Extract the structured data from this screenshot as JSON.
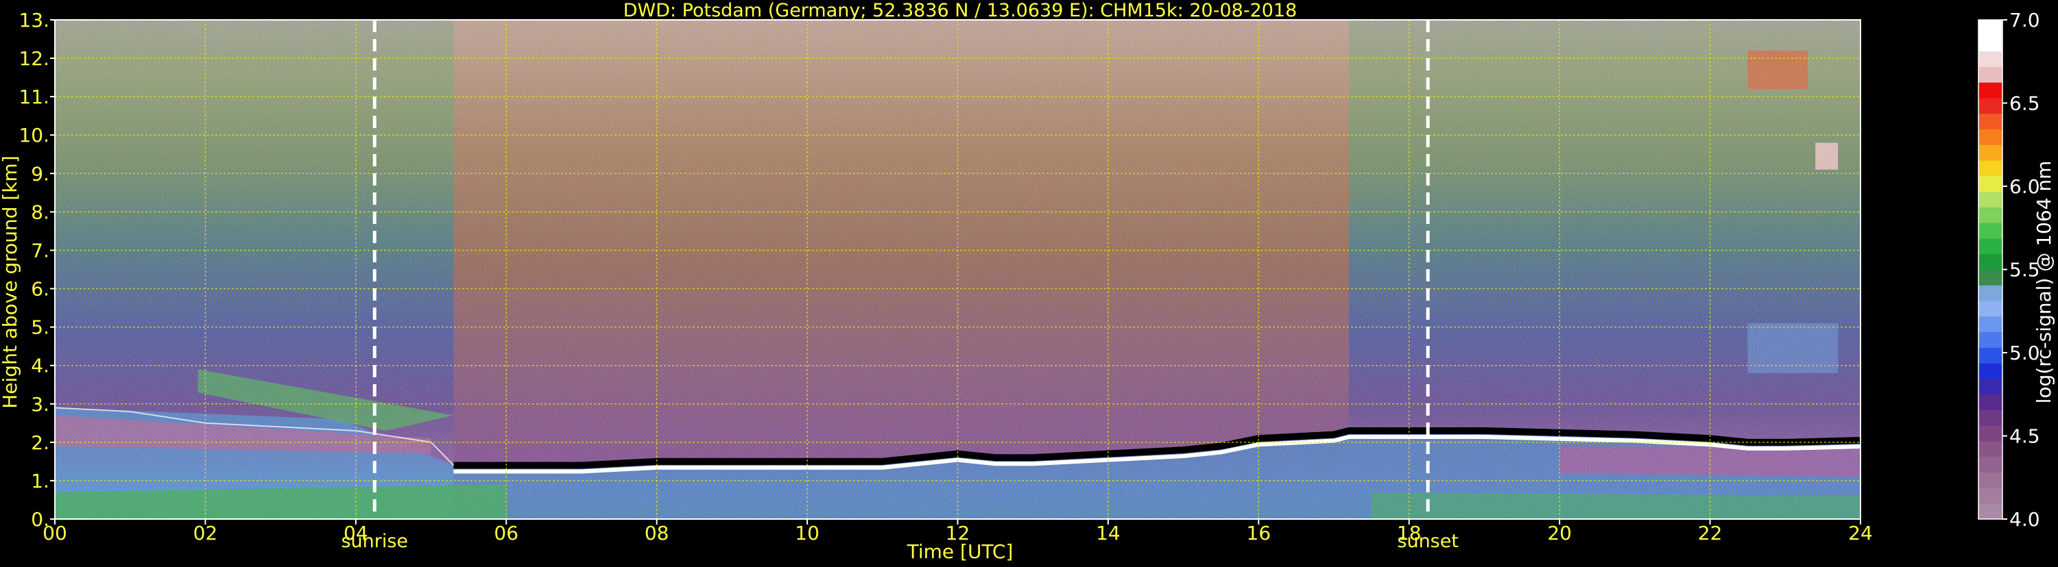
{
  "chart_data": {
    "type": "heatmap",
    "title": "DWD: Potsdam (Germany; 52.3836 N / 13.0639 E):    CHM15k: 20-08-2018",
    "xlabel": "Time [UTC]",
    "ylabel": "Height above ground [km]",
    "xlim": [
      0,
      24
    ],
    "ylim": [
      0,
      13
    ],
    "x_ticks": [
      "00",
      "02",
      "04",
      "06",
      "08",
      "10",
      "12",
      "14",
      "16",
      "18",
      "20",
      "22",
      "24"
    ],
    "y_ticks": [
      "0.",
      "1.",
      "2.",
      "3.",
      "4.",
      "5.",
      "6.",
      "7.",
      "8.",
      "9.",
      "10.",
      "11.",
      "12.",
      "13."
    ],
    "grid": true,
    "annotations": [
      {
        "label": "sunrise",
        "x": 4.25
      },
      {
        "label": "sunset",
        "x": 18.25
      }
    ],
    "colorbar": {
      "label": "log(rc-signal) @ 1064 nm",
      "range": [
        4.0,
        7.0
      ],
      "ticks": [
        "4.0",
        "4.5",
        "5.0",
        "5.5",
        "6.0",
        "6.5",
        "7.0"
      ],
      "colors": [
        "#a98aa4",
        "#a37f9d",
        "#9c7296",
        "#93648f",
        "#8a5688",
        "#7d4682",
        "#6e3a86",
        "#5a2a8f",
        "#3a2ab0",
        "#1d2fd8",
        "#2b55e6",
        "#4c79ee",
        "#6d96f0",
        "#8fb0f2",
        "#7ca8dc",
        "#3b8c4a",
        "#1f9a3a",
        "#2ab344",
        "#4bc44e",
        "#7fd25a",
        "#b2e064",
        "#e6ec44",
        "#f8d21e",
        "#f9a91a",
        "#f77e1a",
        "#f25a22",
        "#ea2a20",
        "#f00c0c",
        "#e9bcc0",
        "#f2dada",
        "#ffffff",
        "#ffffff"
      ]
    },
    "series": [
      {
        "name": "cloud base height (white/black band)",
        "x": [
          5.3,
          6,
          7,
          8,
          9,
          10,
          11,
          12,
          12.5,
          13,
          14,
          15,
          15.5,
          16,
          17,
          17.2,
          18,
          19,
          20,
          21,
          22,
          22.5,
          23,
          24
        ],
        "y": [
          1.4,
          1.4,
          1.4,
          1.5,
          1.5,
          1.5,
          1.5,
          1.7,
          1.6,
          1.6,
          1.7,
          1.8,
          1.9,
          2.1,
          2.2,
          2.3,
          2.3,
          2.3,
          2.25,
          2.2,
          2.1,
          2.0,
          2.0,
          2.05
        ]
      },
      {
        "name": "residual layer top",
        "x": [
          0,
          1,
          2,
          3,
          4,
          5,
          5.3
        ],
        "y": [
          2.9,
          2.8,
          2.5,
          2.4,
          2.3,
          2.0,
          1.4
        ]
      }
    ]
  }
}
